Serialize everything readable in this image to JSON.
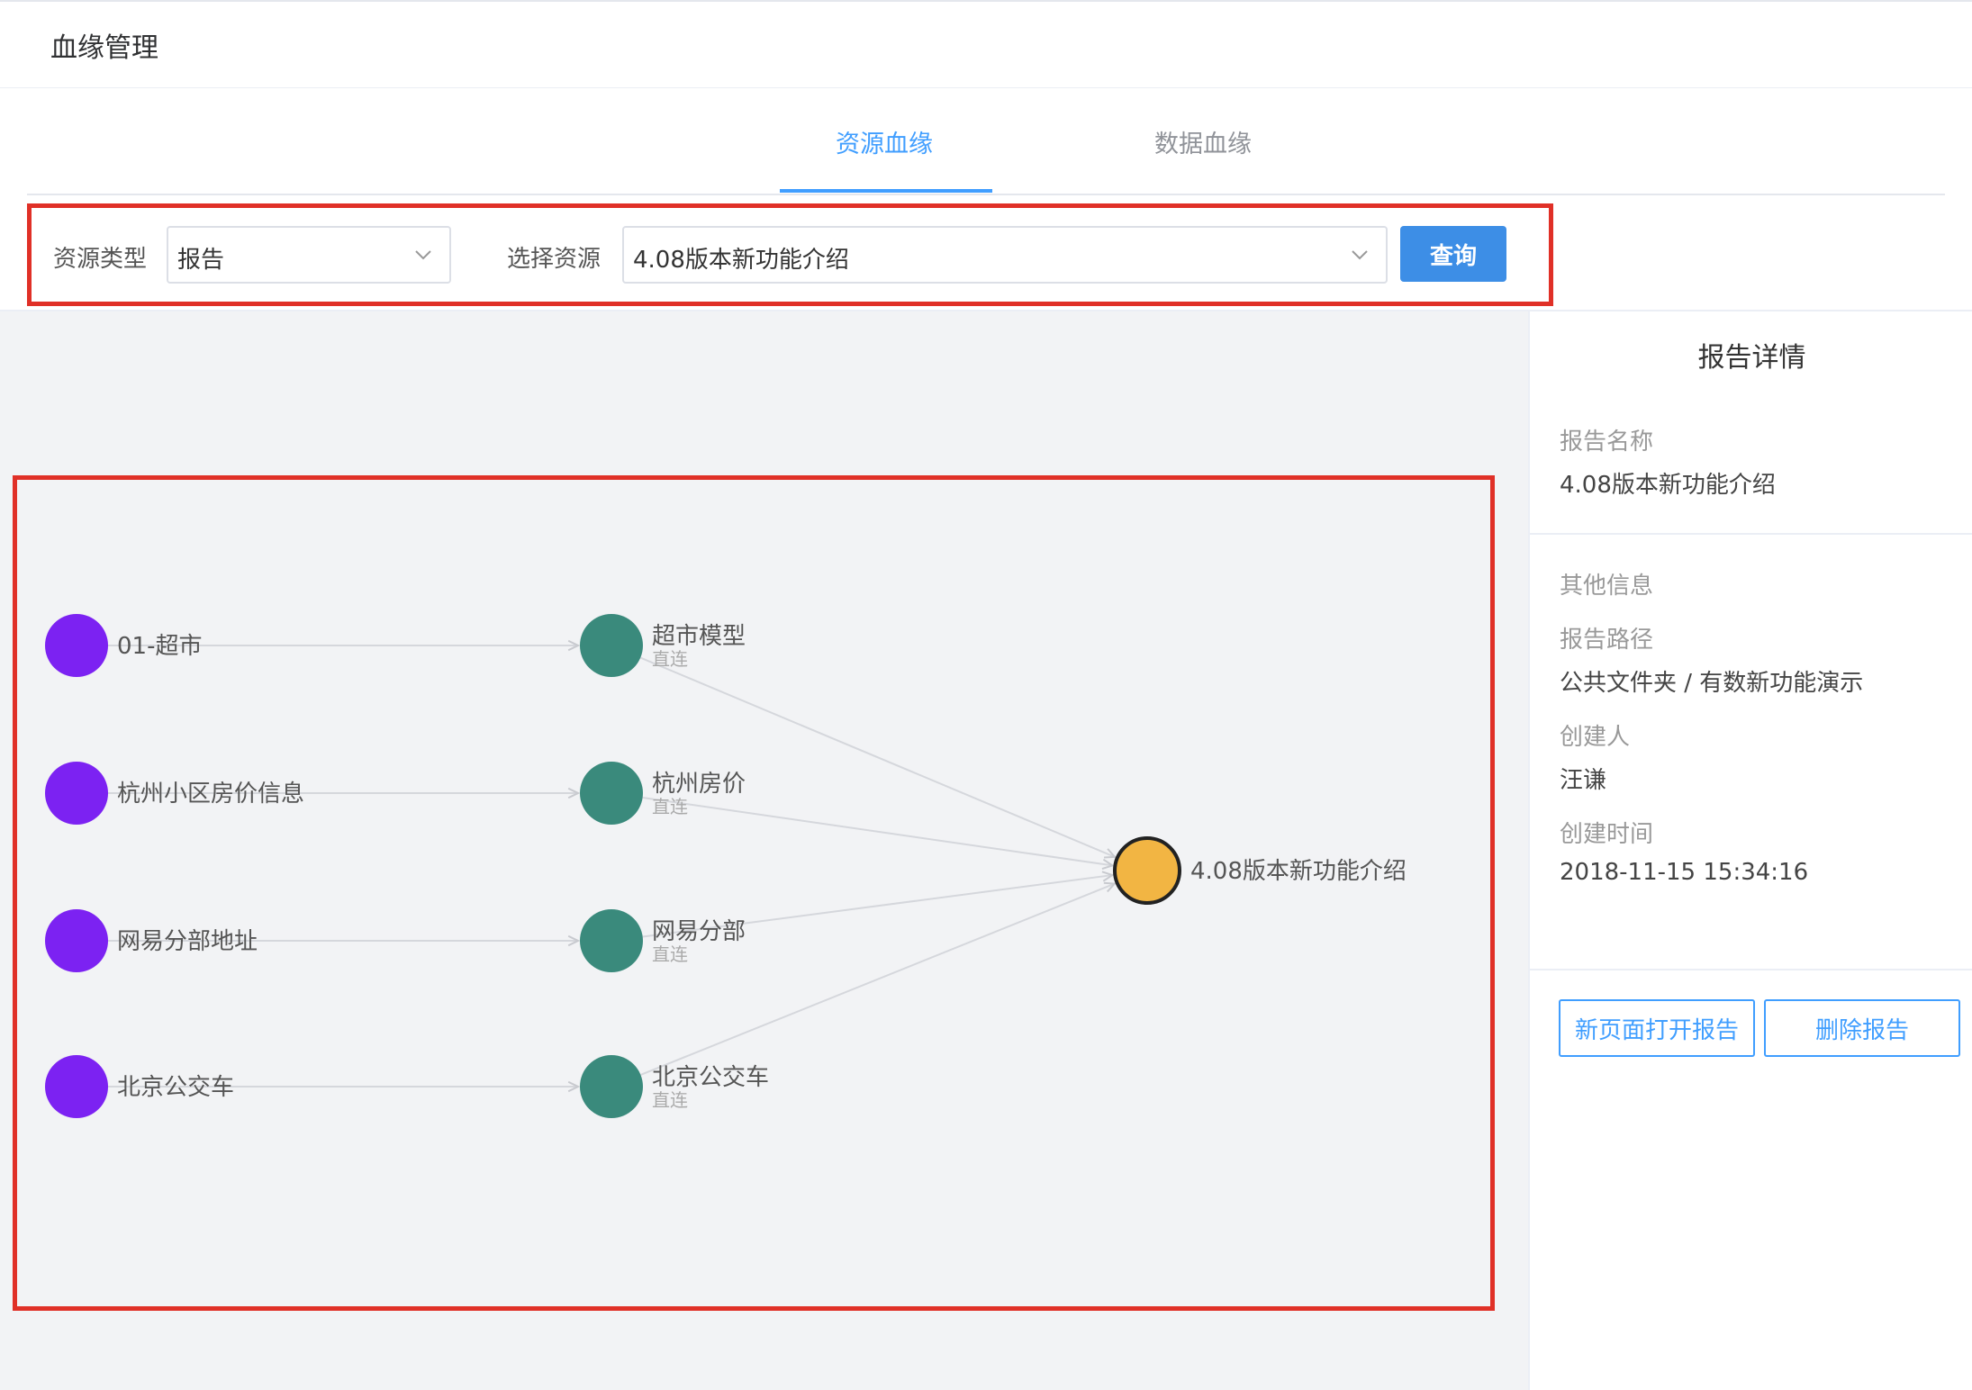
{
  "header": {
    "title": "血缘管理"
  },
  "tabs": [
    {
      "label": "资源血缘",
      "active": true
    },
    {
      "label": "数据血缘",
      "active": false
    }
  ],
  "filters": {
    "resource_type_label": "资源类型",
    "resource_type_value": "报告",
    "select_resource_label": "选择资源",
    "select_resource_value": "4.08版本新功能介绍",
    "query_button": "查询"
  },
  "graph": {
    "sources": [
      {
        "label": "01-超市"
      },
      {
        "label": "杭州小区房价信息"
      },
      {
        "label": "网易分部地址"
      },
      {
        "label": "北京公交车"
      }
    ],
    "models": [
      {
        "label": "超市模型",
        "sub": "直连"
      },
      {
        "label": "杭州房价",
        "sub": "直连"
      },
      {
        "label": "网易分部",
        "sub": "直连"
      },
      {
        "label": "北京公交车",
        "sub": "直连"
      }
    ],
    "target": {
      "label": "4.08版本新功能介绍"
    },
    "colors": {
      "source": "#7c22f2",
      "model": "#3a8a7c",
      "target": "#f2b543",
      "edge": "#d5d7dc"
    }
  },
  "details": {
    "title": "报告详情",
    "name_label": "报告名称",
    "name_value": "4.08版本新功能介绍",
    "other_label": "其他信息",
    "path_label": "报告路径",
    "path_value": "公共文件夹 / 有数新功能演示",
    "creator_label": "创建人",
    "creator_value": "汪谦",
    "time_label": "创建时间",
    "time_value": "2018-11-15 15:34:16",
    "open_button": "新页面打开报告",
    "delete_button": "删除报告"
  }
}
